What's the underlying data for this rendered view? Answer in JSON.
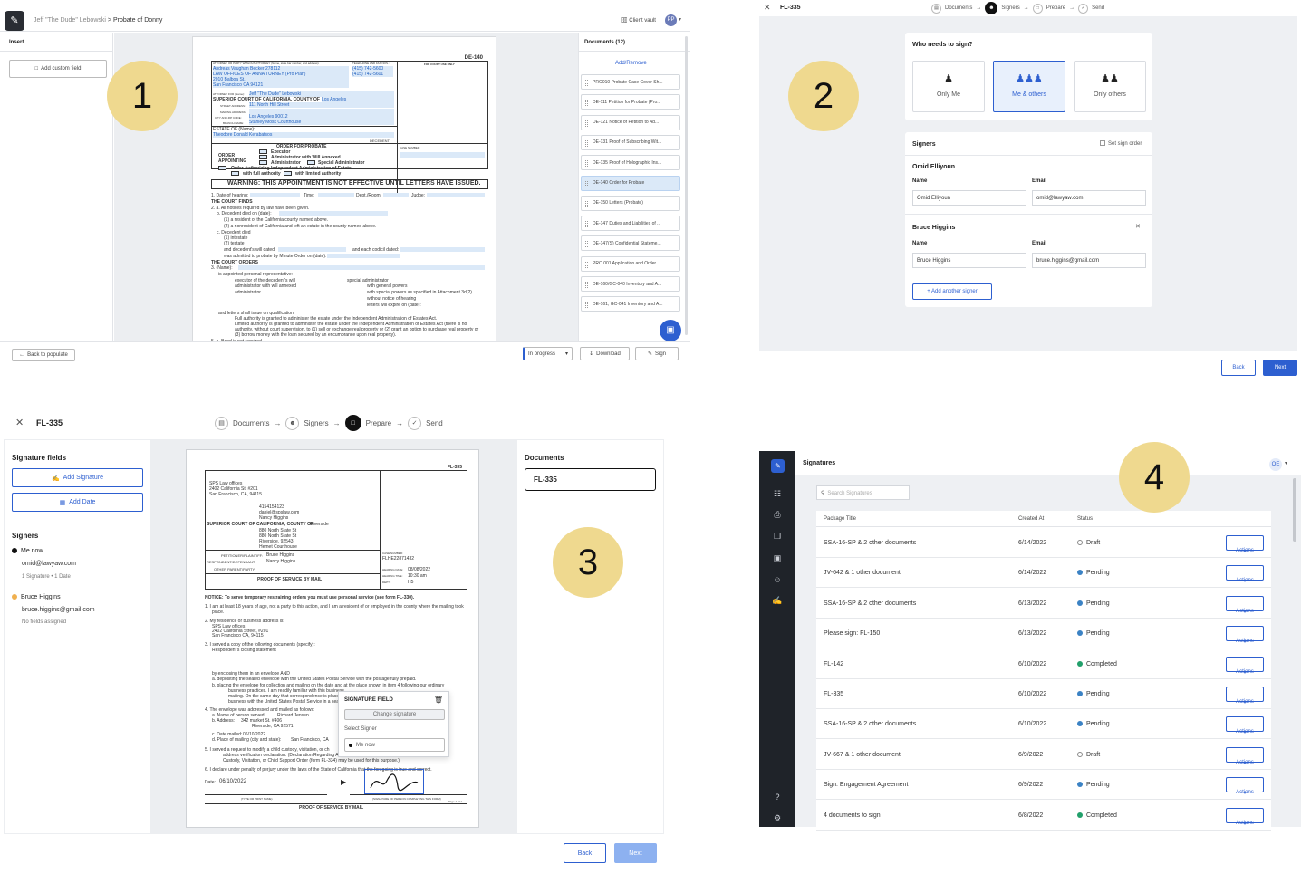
{
  "annotations": {
    "p1": "1",
    "p2": "2",
    "p3": "3",
    "p4": "4"
  },
  "panel1": {
    "breadcrumb_user": "Jeff \"The Dude\" Lebowski",
    "breadcrumb_sep": ">",
    "breadcrumb_case": "Probate of Donny",
    "client_vault": "Client vault",
    "avatar": "PP",
    "insert_label": "Insert",
    "add_custom_field": "Add custom field",
    "documents_header": "Documents (12)",
    "add_remove": "Add/Remove",
    "documents": [
      "PRO010 Probate Case Cover Sh...",
      "DE-111 Petition for Probate (Pro...",
      "DE-121 Notice of Petition to Ad...",
      "DE-131 Proof of Subscribing Wit...",
      "DE-135 Proof of Holographic Ins...",
      "DE-140 Order for Probate",
      "DE-150 Letters (Probate)",
      "DE-147 Duties and Liabilities of ...",
      "DE-147(S) Confidential Stateme...",
      "PRO 001 Application and Order ...",
      "DE-160/GC-040 Inventory and A...",
      "DE-161, GC-041 Inventory and A..."
    ],
    "back_to_populate": "Back to populate",
    "status": "In progress",
    "download": "Download",
    "sign": "Sign",
    "form": {
      "code": "DE-140",
      "attorney_line": "ATTORNEY OR PARTY WITHOUT ATTORNEY (Name, state bar number, and address):",
      "tel_label": "TELEPHONE AND FAX NOS.:",
      "court_use": "FOR COURT USE ONLY",
      "atty_name": "Andreas Vaughan Becker 278112",
      "firm": "LAW OFFICES OF ANNA TURNEY (Pro Plan)",
      "street": "2010 Balboa St.",
      "city": "San Francisco CA 94121",
      "phone1": "(415) 742-5600",
      "phone2": "(415) 742-5601",
      "attorney_for_label": "ATTORNEY FOR (Name):",
      "attorney_for": "Jeff \"The Dude\" Lebowski",
      "court_label": "SUPERIOR COURT OF CALIFORNIA, COUNTY OF",
      "county": "Los Angeles",
      "street_address_label": "STREET ADDRESS:",
      "court_street": "111 North Hill Street",
      "mailing_label": "MAILING ADDRESS:",
      "city_zip_label": "CITY AND ZIP CODE:",
      "court_city": "Los Angeles 90012",
      "branch_label": "BRANCH NAME:",
      "branch": "Stanley Mosk Courthouse",
      "estate_label": "ESTATE OF (Name):",
      "decedent": "Theodore Donald Kerabatsos",
      "decedent_label": "DECEDENT",
      "order_title": "ORDER FOR PROBATE",
      "order_appointing": "ORDER APPOINTING",
      "executor": "Executor",
      "admin_will": "Administrator with Will Annexed",
      "administrator": "Administrator",
      "special_admin": "Special Administrator",
      "order_auth": "Order Authorizing Independent Administration of Estate",
      "full_auth": "with full authority",
      "limited_auth": "with limited authority",
      "case_number_label": "CASE NUMBER:",
      "warning": "WARNING: THIS APPOINTMENT IS NOT EFFECTIVE UNTIL LETTERS HAVE ISSUED.",
      "date_hearing": "1. Date of hearing:",
      "time": "Time:",
      "dept": "Dept./Room:",
      "judge": "Judge:",
      "court_finds": "THE COURT FINDS",
      "notices": "2. a. All notices required by law have been given.",
      "decedent_died": "b. Decedent died on (date):",
      "resident": "(1)  a resident of the California county named above.",
      "nonresident": "(2)  a nonresident of California and left an estate in the county named above.",
      "c_decedent": "c. Decedent died",
      "intestate": "(1)  intestate",
      "testate": "(2)  testate",
      "will_dated": "and decedent's will dated:",
      "codicil": "and each codicil dated:",
      "admitted": "was admitted to probate by Minute Order on (date):",
      "court_orders": "THE COURT ORDERS",
      "name3": "3. (Name):",
      "appointed": "is appointed personal representative:",
      "exec_estate": "executor of the decedent's will",
      "admin_annexed": "administrator with will annexed",
      "admin_plain": "administrator",
      "special": "special administrator",
      "general_powers": "with general powers",
      "special_powers": "with special powers as specified in Attachment 3d(2)",
      "without_notice": "without notice of hearing",
      "letters_expire": "letters will expire on (date):",
      "letters_issue": "and letters shall issue on qualification.",
      "full_authority_text": "Full authority is granted to administer the estate under the Independent Administration of Estates Act.",
      "limited_authority_text": "Limited authority is granted to administer the estate under the Independent Administration of Estates Act (there is no",
      "limited_authority_text2": "authority, without court supervision, to (1) sell or exchange real property or (2) grant an option to purchase real property or",
      "limited_authority_text3": "(3) borrow money with the loan secured by an encumbrance upon real property).",
      "bond_not_required": "5. a.  Bond is not required."
    }
  },
  "panel2": {
    "doc_title": "FL-335",
    "steps": [
      "Documents",
      "Signers",
      "Prepare",
      "Send"
    ],
    "who_needs": "Who needs to sign?",
    "options": [
      "Only Me",
      "Me & others",
      "Only others"
    ],
    "signers_header": "Signers",
    "set_sign_order": "Set sign order",
    "signer1_name": "Omid Elliyoun",
    "signer1_email": "omid@lawyaw.com",
    "signer2_name": "Bruce Higgins",
    "signer2_email": "bruce.higgins@gmail.com",
    "name_label": "Name",
    "email_label": "Email",
    "add_another": "+ Add another signer",
    "back": "Back",
    "next": "Next"
  },
  "panel3": {
    "doc_title": "FL-335",
    "steps": [
      "Documents",
      "Signers",
      "Prepare",
      "Send"
    ],
    "signature_fields": "Signature fields",
    "add_signature": "Add Signature",
    "add_date": "Add Date",
    "signers_label": "Signers",
    "me_now": "Me now",
    "me_email": "omid@lawyaw.com",
    "me_counts": "1 Signature • 1 Date",
    "bruce": "Bruce Higgins",
    "bruce_email": "bruce.higgins@gmail.com",
    "no_fields": "No fields assigned",
    "documents_label": "Documents",
    "doc_selected": "FL-335",
    "popup_title": "SIGNATURE FIELD",
    "change_signature": "Change signature",
    "select_signer": "Select Signer",
    "popup_me_now": "Me now",
    "back": "Back",
    "next": "Next",
    "form": {
      "code": "FL-335",
      "firm": "SPS Law offices",
      "street": "2402 California St, #201",
      "city": "San Francisco, CA, 94115",
      "phone": "4154154123",
      "email": "daniel@spslaw.com",
      "attorney_for": "Nancy Higgins",
      "court_label": "SUPERIOR COURT OF CALIFORNIA, COUNTY OF",
      "county": "Riverside",
      "street_address": "880 North State St",
      "mailing_address": "880 North State St",
      "city_zip": "Riverside, 92543",
      "branch": "Hemet Courthouse",
      "petitioner_label": "PETITIONER/PLAINTIFF:",
      "petitioner": "Bruce Higgins",
      "respondent_label": "RESPONDENT/DEFENDANT:",
      "respondent": "Nancy Higgins",
      "other_parent": "OTHER PARENT/PARTY:",
      "title": "PROOF OF SERVICE BY MAIL",
      "case_number_label": "CASE NUMBER:",
      "case_number": "FLHE22871432",
      "hearing_date_label": "HEARING DATE:",
      "hearing_date": "08/08/2022",
      "hearing_time_label": "HEARING TIME:",
      "hearing_time": "10:30 am",
      "dept_label": "DEPT.:",
      "dept": "H5",
      "notice": "NOTICE:  To serve temporary restraining orders you must use personal service (see form FL-330).",
      "item1": "1.  I am at least 18 years of age, not a party to this action, and I am a resident of or employed in the county where the mailing took",
      "item1b": "place.",
      "item2": "2.  My residence or business address is:",
      "item2_addr1": "SPS Law offices",
      "item2_addr2": "2402 California Street, #201",
      "item2_addr3": "San Francisco CA, 94115",
      "item3": "3.  I served a copy of the following documents (specify):",
      "item3_doc": "Respondent's closing statement",
      "enclosing": "by enclosing them in an envelope AND",
      "depositing": "a.  depositing the sealed envelope with the United States Postal Service with the postage fully prepaid.",
      "placing": "b.  placing the envelope for collection and mailing on the date and at the place shown in item 4 following our ordinary",
      "placing2": "business practices. I am readily familiar with this business",
      "placing3": "mailing. On the same day that correspondence is placed",
      "placing4": "business with the United States Postal Service in a seale",
      "item4": "4.  The envelope was addressed and mailed as follows:",
      "item4a": "a.  Name of person served:",
      "item4a_val": "Richard Jensen",
      "item4b": "b.  Address:",
      "item4b_val": "342 market St. #406",
      "item4b_val2": "Riverside, CA 92571",
      "item4c": "c.  Date mailed:",
      "item4c_val": "06/10/2022",
      "item4d": "d.  Place of mailing (city and state):",
      "item4d_val": "San Francisco, CA",
      "item5": "5.  I served a request to modify a child custody, visitation, or ch",
      "item5b": "address verification declaration. (Declaration Regarding Ad",
      "item5c": "Custody, Visitation, or Child Support Order (form FL-334) may be used for this purpose.)",
      "item6": "6.  I declare under penalty of perjury under the laws of the State of California that the foregoing is true and correct.",
      "date_label": "Date:",
      "date_val": "06/10/2022",
      "type_name": "(TYPE OR PRINT NAME)",
      "sig_label": "(SIGNATURE OF PERSON COMPLETING THIS FORM)",
      "footer_title": "PROOF OF SERVICE BY MAIL",
      "page": "Page 1 of 1"
    }
  },
  "panel4": {
    "title": "Signatures",
    "avatar": "OE",
    "search_placeholder": "Search Signatures",
    "col_package": "Package Title",
    "col_created": "Created At",
    "col_status": "Status",
    "actions": "Actions",
    "rows": [
      {
        "title": "SSA-16-SP & 2 other documents",
        "date": "6/14/2022",
        "status": "Draft"
      },
      {
        "title": "JV-642 & 1 other document",
        "date": "6/14/2022",
        "status": "Pending"
      },
      {
        "title": "SSA-16-SP & 2 other documents",
        "date": "6/13/2022",
        "status": "Pending"
      },
      {
        "title": "Please sign: FL-150",
        "date": "6/13/2022",
        "status": "Pending"
      },
      {
        "title": "FL-142",
        "date": "6/10/2022",
        "status": "Completed"
      },
      {
        "title": "FL-335",
        "date": "6/10/2022",
        "status": "Pending"
      },
      {
        "title": "SSA-16-SP & 2 other documents",
        "date": "6/10/2022",
        "status": "Pending"
      },
      {
        "title": "JV-667 & 1 other document",
        "date": "6/9/2022",
        "status": "Draft"
      },
      {
        "title": "Sign: Engagement Agreement",
        "date": "6/9/2022",
        "status": "Pending"
      },
      {
        "title": "4 documents to sign",
        "date": "6/8/2022",
        "status": "Completed"
      }
    ],
    "colors": {
      "Draft": "#888888",
      "Pending": "#3b82c4",
      "Completed": "#22a06b"
    }
  },
  "colors": {
    "accent": "#2d5fd0",
    "annotation": "#efd98f",
    "sidebar": "#1f2329"
  }
}
